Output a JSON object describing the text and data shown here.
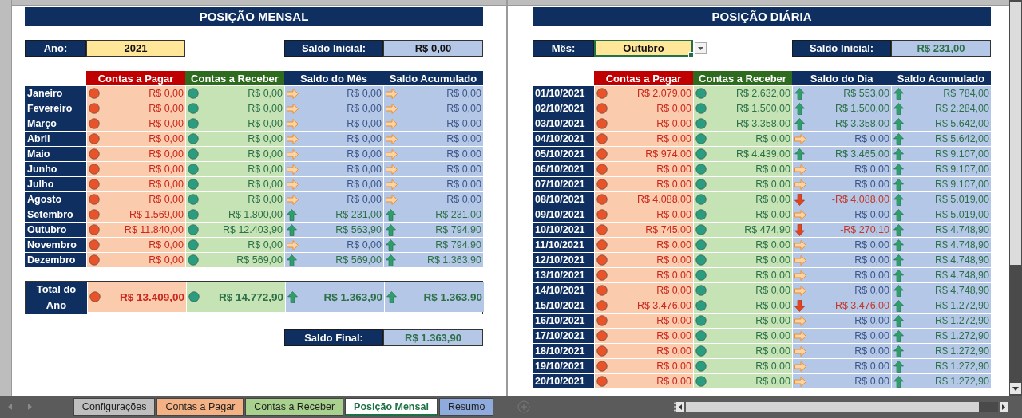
{
  "monthly": {
    "title": "POSIÇÃO MENSAL",
    "year_label": "Ano:",
    "year": "2021",
    "opening_label": "Saldo Inicial:",
    "opening": {
      "value": "R$ 0,00",
      "kind": "flat"
    },
    "columns": [
      "Contas a Pagar",
      "Contas a Receber",
      "Saldo do Mês",
      "Saldo Acumulado"
    ],
    "rows": [
      {
        "label": "Janeiro",
        "pay": "R$ 0,00",
        "receive": "R$ 0,00",
        "balance": {
          "value": "R$ 0,00",
          "kind": "flat"
        },
        "cumulative": {
          "value": "R$ 0,00",
          "kind": "flat"
        }
      },
      {
        "label": "Fevereiro",
        "pay": "R$ 0,00",
        "receive": "R$ 0,00",
        "balance": {
          "value": "R$ 0,00",
          "kind": "flat"
        },
        "cumulative": {
          "value": "R$ 0,00",
          "kind": "flat"
        }
      },
      {
        "label": "Março",
        "pay": "R$ 0,00",
        "receive": "R$ 0,00",
        "balance": {
          "value": "R$ 0,00",
          "kind": "flat"
        },
        "cumulative": {
          "value": "R$ 0,00",
          "kind": "flat"
        }
      },
      {
        "label": "Abril",
        "pay": "R$ 0,00",
        "receive": "R$ 0,00",
        "balance": {
          "value": "R$ 0,00",
          "kind": "flat"
        },
        "cumulative": {
          "value": "R$ 0,00",
          "kind": "flat"
        }
      },
      {
        "label": "Maio",
        "pay": "R$ 0,00",
        "receive": "R$ 0,00",
        "balance": {
          "value": "R$ 0,00",
          "kind": "flat"
        },
        "cumulative": {
          "value": "R$ 0,00",
          "kind": "flat"
        }
      },
      {
        "label": "Junho",
        "pay": "R$ 0,00",
        "receive": "R$ 0,00",
        "balance": {
          "value": "R$ 0,00",
          "kind": "flat"
        },
        "cumulative": {
          "value": "R$ 0,00",
          "kind": "flat"
        }
      },
      {
        "label": "Julho",
        "pay": "R$ 0,00",
        "receive": "R$ 0,00",
        "balance": {
          "value": "R$ 0,00",
          "kind": "flat"
        },
        "cumulative": {
          "value": "R$ 0,00",
          "kind": "flat"
        }
      },
      {
        "label": "Agosto",
        "pay": "R$ 0,00",
        "receive": "R$ 0,00",
        "balance": {
          "value": "R$ 0,00",
          "kind": "flat"
        },
        "cumulative": {
          "value": "R$ 0,00",
          "kind": "flat"
        }
      },
      {
        "label": "Setembro",
        "pay": "R$ 1.569,00",
        "receive": "R$ 1.800,00",
        "balance": {
          "value": "R$ 231,00",
          "kind": "up"
        },
        "cumulative": {
          "value": "R$ 231,00",
          "kind": "up"
        }
      },
      {
        "label": "Outubro",
        "pay": "R$ 11.840,00",
        "receive": "R$ 12.403,90",
        "balance": {
          "value": "R$ 563,90",
          "kind": "up"
        },
        "cumulative": {
          "value": "R$ 794,90",
          "kind": "up"
        }
      },
      {
        "label": "Novembro",
        "pay": "R$ 0,00",
        "receive": "R$ 0,00",
        "balance": {
          "value": "R$ 0,00",
          "kind": "flat"
        },
        "cumulative": {
          "value": "R$ 794,90",
          "kind": "up"
        }
      },
      {
        "label": "Dezembro",
        "pay": "R$ 0,00",
        "receive": "R$ 569,00",
        "balance": {
          "value": "R$ 569,00",
          "kind": "up"
        },
        "cumulative": {
          "value": "R$ 1.363,90",
          "kind": "up"
        }
      }
    ],
    "total": {
      "label": "Total do Ano",
      "pay": "R$ 13.409,00",
      "receive": "R$ 14.772,90",
      "balance": {
        "value": "R$ 1.363,90",
        "kind": "up"
      },
      "cumulative": {
        "value": "R$ 1.363,90",
        "kind": "up"
      }
    },
    "final_label": "Saldo Final:",
    "final": {
      "value": "R$ 1.363,90",
      "kind": "up"
    }
  },
  "daily": {
    "title": "POSIÇÃO DIÁRIA",
    "month_label": "Mês:",
    "month": "Outubro",
    "opening_label": "Saldo Inicial:",
    "opening": {
      "value": "R$ 231,00",
      "kind": "up"
    },
    "columns": [
      "Contas a Pagar",
      "Contas a Receber",
      "Saldo do Dia",
      "Saldo Acumulado"
    ],
    "rows": [
      {
        "label": "01/10/2021",
        "pay": "R$ 2.079,00",
        "receive": "R$ 2.632,00",
        "balance": {
          "value": "R$ 553,00",
          "kind": "up"
        },
        "cumulative": {
          "value": "R$ 784,00",
          "kind": "up"
        }
      },
      {
        "label": "02/10/2021",
        "pay": "R$ 0,00",
        "receive": "R$ 1.500,00",
        "balance": {
          "value": "R$ 1.500,00",
          "kind": "up"
        },
        "cumulative": {
          "value": "R$ 2.284,00",
          "kind": "up"
        }
      },
      {
        "label": "03/10/2021",
        "pay": "R$ 0,00",
        "receive": "R$ 3.358,00",
        "balance": {
          "value": "R$ 3.358,00",
          "kind": "up"
        },
        "cumulative": {
          "value": "R$ 5.642,00",
          "kind": "up"
        }
      },
      {
        "label": "04/10/2021",
        "pay": "R$ 0,00",
        "receive": "R$ 0,00",
        "balance": {
          "value": "R$ 0,00",
          "kind": "flat"
        },
        "cumulative": {
          "value": "R$ 5.642,00",
          "kind": "up"
        }
      },
      {
        "label": "05/10/2021",
        "pay": "R$ 974,00",
        "receive": "R$ 4.439,00",
        "balance": {
          "value": "R$ 3.465,00",
          "kind": "up"
        },
        "cumulative": {
          "value": "R$ 9.107,00",
          "kind": "up"
        }
      },
      {
        "label": "06/10/2021",
        "pay": "R$ 0,00",
        "receive": "R$ 0,00",
        "balance": {
          "value": "R$ 0,00",
          "kind": "flat"
        },
        "cumulative": {
          "value": "R$ 9.107,00",
          "kind": "up"
        }
      },
      {
        "label": "07/10/2021",
        "pay": "R$ 0,00",
        "receive": "R$ 0,00",
        "balance": {
          "value": "R$ 0,00",
          "kind": "flat"
        },
        "cumulative": {
          "value": "R$ 9.107,00",
          "kind": "up"
        }
      },
      {
        "label": "08/10/2021",
        "pay": "R$ 4.088,00",
        "receive": "R$ 0,00",
        "balance": {
          "value": "-R$ 4.088,00",
          "kind": "down"
        },
        "cumulative": {
          "value": "R$ 5.019,00",
          "kind": "up"
        }
      },
      {
        "label": "09/10/2021",
        "pay": "R$ 0,00",
        "receive": "R$ 0,00",
        "balance": {
          "value": "R$ 0,00",
          "kind": "flat"
        },
        "cumulative": {
          "value": "R$ 5.019,00",
          "kind": "up"
        }
      },
      {
        "label": "10/10/2021",
        "pay": "R$ 745,00",
        "receive": "R$ 474,90",
        "balance": {
          "value": "-R$ 270,10",
          "kind": "down"
        },
        "cumulative": {
          "value": "R$ 4.748,90",
          "kind": "up"
        }
      },
      {
        "label": "11/10/2021",
        "pay": "R$ 0,00",
        "receive": "R$ 0,00",
        "balance": {
          "value": "R$ 0,00",
          "kind": "flat"
        },
        "cumulative": {
          "value": "R$ 4.748,90",
          "kind": "up"
        }
      },
      {
        "label": "12/10/2021",
        "pay": "R$ 0,00",
        "receive": "R$ 0,00",
        "balance": {
          "value": "R$ 0,00",
          "kind": "flat"
        },
        "cumulative": {
          "value": "R$ 4.748,90",
          "kind": "up"
        }
      },
      {
        "label": "13/10/2021",
        "pay": "R$ 0,00",
        "receive": "R$ 0,00",
        "balance": {
          "value": "R$ 0,00",
          "kind": "flat"
        },
        "cumulative": {
          "value": "R$ 4.748,90",
          "kind": "up"
        }
      },
      {
        "label": "14/10/2021",
        "pay": "R$ 0,00",
        "receive": "R$ 0,00",
        "balance": {
          "value": "R$ 0,00",
          "kind": "flat"
        },
        "cumulative": {
          "value": "R$ 4.748,90",
          "kind": "up"
        }
      },
      {
        "label": "15/10/2021",
        "pay": "R$ 3.476,00",
        "receive": "R$ 0,00",
        "balance": {
          "value": "-R$ 3.476,00",
          "kind": "down"
        },
        "cumulative": {
          "value": "R$ 1.272,90",
          "kind": "up"
        }
      },
      {
        "label": "16/10/2021",
        "pay": "R$ 0,00",
        "receive": "R$ 0,00",
        "balance": {
          "value": "R$ 0,00",
          "kind": "flat"
        },
        "cumulative": {
          "value": "R$ 1.272,90",
          "kind": "up"
        }
      },
      {
        "label": "17/10/2021",
        "pay": "R$ 0,00",
        "receive": "R$ 0,00",
        "balance": {
          "value": "R$ 0,00",
          "kind": "flat"
        },
        "cumulative": {
          "value": "R$ 1.272,90",
          "kind": "up"
        }
      },
      {
        "label": "18/10/2021",
        "pay": "R$ 0,00",
        "receive": "R$ 0,00",
        "balance": {
          "value": "R$ 0,00",
          "kind": "flat"
        },
        "cumulative": {
          "value": "R$ 1.272,90",
          "kind": "up"
        }
      },
      {
        "label": "19/10/2021",
        "pay": "R$ 0,00",
        "receive": "R$ 0,00",
        "balance": {
          "value": "R$ 0,00",
          "kind": "flat"
        },
        "cumulative": {
          "value": "R$ 1.272,90",
          "kind": "up"
        }
      },
      {
        "label": "20/10/2021",
        "pay": "R$ 0,00",
        "receive": "R$ 0,00",
        "balance": {
          "value": "R$ 0,00",
          "kind": "flat"
        },
        "cumulative": {
          "value": "R$ 1.272,90",
          "kind": "up"
        }
      }
    ]
  },
  "sheet_tabs": [
    {
      "label": "Configurações",
      "color": "#bfbfbf",
      "selected": false
    },
    {
      "label": "Contas a Pagar",
      "color": "#f4b183",
      "selected": false
    },
    {
      "label": "Contas a Receber",
      "color": "#a9d18e",
      "selected": false
    },
    {
      "label": "Posição Mensal",
      "color": "#ffffff",
      "selected": true
    },
    {
      "label": "Resumo",
      "color": "#8faadc",
      "selected": false
    }
  ]
}
